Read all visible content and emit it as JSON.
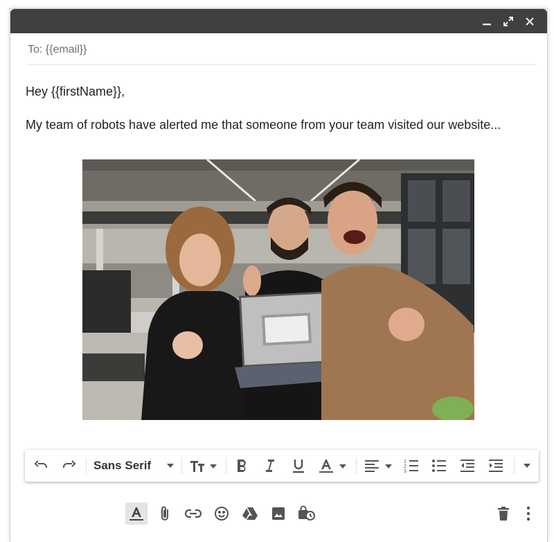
{
  "compose": {
    "to_text": "To: {{email}}",
    "greeting": "Hey {{firstName}},",
    "body_line": "My team of robots have alerted me that someone from your team visited our website..."
  },
  "toolbar": {
    "font_name": "Sans Serif"
  },
  "window_controls": [
    "minimize-icon",
    "expand-icon",
    "close-icon"
  ],
  "format_icons": [
    "undo-icon",
    "redo-icon",
    "font-dropdown-icon",
    "text-size-icon",
    "bold-icon",
    "italic-icon",
    "underline-icon",
    "text-color-icon",
    "align-icon",
    "numbered-list-icon",
    "bulleted-list-icon",
    "indent-less-icon",
    "indent-more-icon",
    "more-formatting-icon"
  ],
  "bottom_icons": [
    "formatting-options-icon",
    "attach-icon",
    "link-icon",
    "emoji-icon",
    "drive-icon",
    "photo-icon",
    "confidential-mode-icon",
    "discard-icon",
    "more-options-icon"
  ],
  "colors": {
    "titlebar": "#404040",
    "icon": "#555555",
    "text": "#222222"
  }
}
